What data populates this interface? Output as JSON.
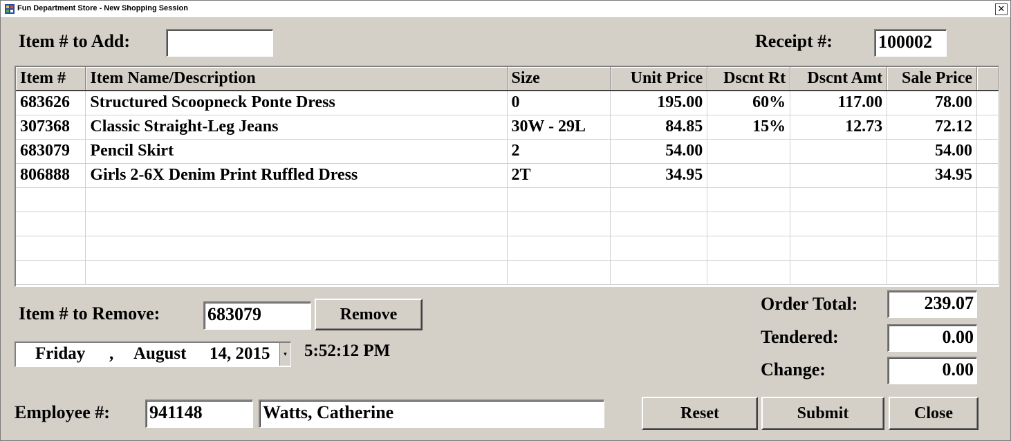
{
  "window": {
    "title": "Fun Department Store - New Shopping Session",
    "close_glyph": "✕"
  },
  "add_item": {
    "label": "Item # to Add:",
    "value": ""
  },
  "receipt": {
    "label": "Receipt #:",
    "value": "100002"
  },
  "grid": {
    "columns": [
      "Item #",
      "Item Name/Description",
      "Size",
      "Unit Price",
      "Dscnt Rt",
      "Dscnt Amt",
      "Sale Price"
    ],
    "rows": [
      [
        "683626",
        "Structured Scoopneck Ponte Dress",
        "0",
        "195.00",
        "60%",
        "117.00",
        "78.00"
      ],
      [
        "307368",
        "Classic Straight-Leg Jeans",
        "30W - 29L",
        "84.85",
        "15%",
        "12.73",
        "72.12"
      ],
      [
        "683079",
        "Pencil Skirt",
        "2",
        "54.00",
        "",
        "",
        "54.00"
      ],
      [
        "806888",
        "Girls 2-6X Denim Print Ruffled Dress",
        "2T",
        "34.95",
        "",
        "",
        "34.95"
      ],
      [
        "",
        "",
        "",
        "",
        "",
        "",
        ""
      ],
      [
        "",
        "",
        "",
        "",
        "",
        "",
        ""
      ],
      [
        "",
        "",
        "",
        "",
        "",
        "",
        ""
      ],
      [
        "",
        "",
        "",
        "",
        "",
        "",
        ""
      ]
    ]
  },
  "remove_item": {
    "label": "Item # to Remove:",
    "value": "683079",
    "button": "Remove"
  },
  "date": {
    "weekday": "Friday",
    "comma": ",",
    "month": "August",
    "day_year": "14, 2015",
    "dropdown_glyph": "▾"
  },
  "time": "5:52:12 PM",
  "totals": {
    "order_total_label": "Order Total:",
    "order_total": "239.07",
    "tendered_label": "Tendered:",
    "tendered": "0.00",
    "change_label": "Change:",
    "change": "0.00"
  },
  "employee": {
    "label": "Employee #:",
    "number": "941148",
    "name": "Watts, Catherine"
  },
  "buttons": {
    "reset": "Reset",
    "submit": "Submit",
    "close": "Close"
  }
}
